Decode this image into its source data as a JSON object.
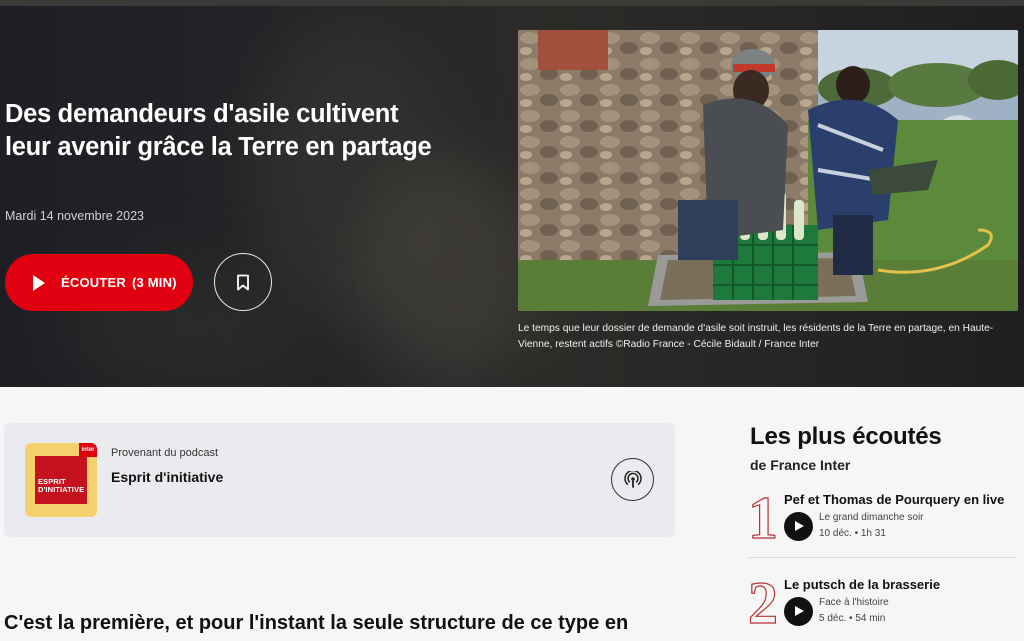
{
  "article": {
    "title": "Des demandeurs d'asile cultivent leur avenir grâce la Terre en partage",
    "date": "Mardi 14 novembre 2023",
    "listen_label": "ÉCOUTER",
    "listen_duration": "(3 MIN)",
    "caption": "Le temps que leur dossier de demande d'asile soit instruit, les résidents de la Terre en partage, en Haute-Vienne, restent actifs ©Radio France - Cécile Bidault / France Inter",
    "body_start": "C'est la première, et pour l'instant la seule structure de ce type en"
  },
  "podcast": {
    "from_label": "Provenant du podcast",
    "name": "Esprit d'initiative",
    "cover_line1": "ESPRIT",
    "cover_line2": "D'INITIATIVE",
    "cover_badge": "inter"
  },
  "sidebar": {
    "title": "Les plus écoutés",
    "subtitle": "de France Inter",
    "items": [
      {
        "rank": "1",
        "title": "Pef et Thomas de Pourquery en live",
        "show": "Le grand dimanche soir",
        "date": "10 déc.",
        "duration": "1h 31"
      },
      {
        "rank": "2",
        "title": "Le putsch de la brasserie",
        "show": "Face à l'histoire",
        "date": "5 déc.",
        "duration": "54 min"
      }
    ]
  },
  "colors": {
    "brand_red": "#e1000f",
    "hero_bg": "#232327",
    "card_bg": "#e9ebee",
    "rank_outline": "#b4323a"
  },
  "icons": [
    "play-icon",
    "bookmark-icon",
    "podcast-icon"
  ]
}
